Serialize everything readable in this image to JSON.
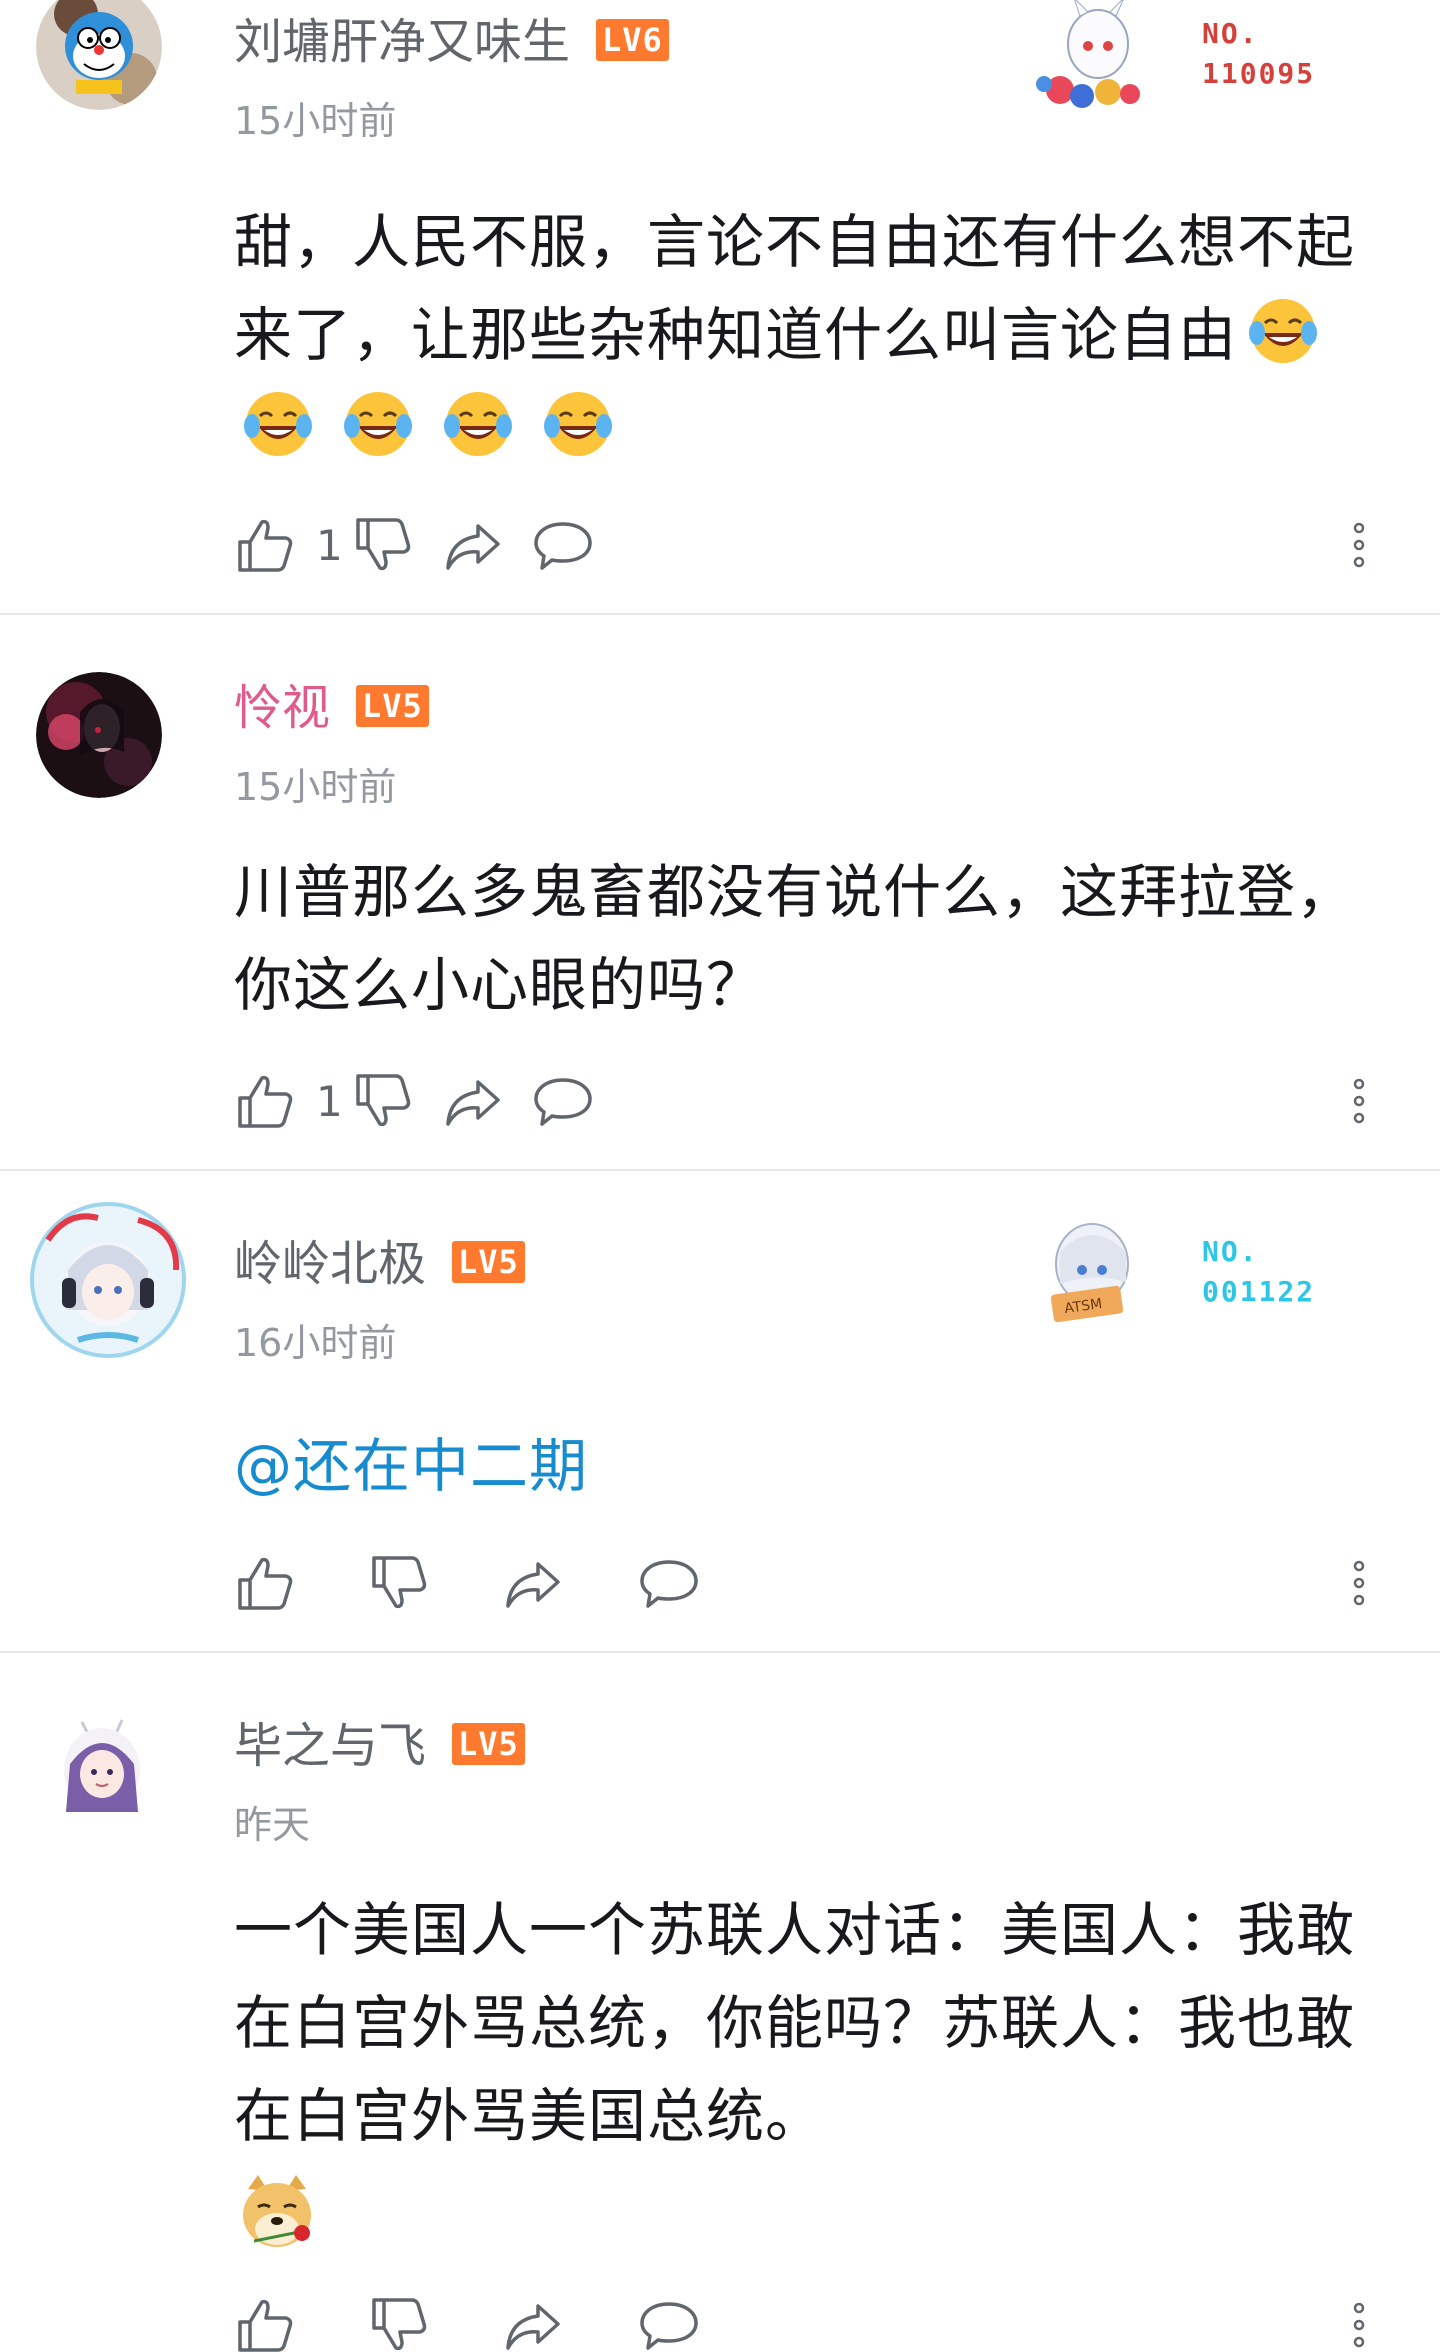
{
  "comments": [
    {
      "username": "刘墉肝净又味生",
      "level": "LV6",
      "time": "15小时前",
      "badge_no": "NO.",
      "badge_id": "110095",
      "text": "甜，人民不服，言论不自由还有什么想不起来了，让那些杂种知道什么叫言论自由",
      "emoji": "laugh-cry-emoji",
      "likes": "1"
    },
    {
      "username": "怜视",
      "level": "LV5",
      "time": "15小时前",
      "text": "川普那么多鬼畜都没有说什么，这拜拉登，你这么小心眼的吗？",
      "likes": "1"
    },
    {
      "username": "岭岭北极",
      "level": "LV5",
      "time": "16小时前",
      "badge_no": "NO.",
      "badge_id": "001122",
      "text": "@还在中二期",
      "likes": ""
    },
    {
      "username": "毕之与飞",
      "level": "LV5",
      "time": "昨天",
      "text": "一个美国人一个苏联人对话：美国人：我敢在白宫外骂总统，你能吗？苏联人：我也敢在白宫外骂美国总统。",
      "emoji": "doge-rose-emoji",
      "likes": ""
    }
  ],
  "icons": {
    "like": "thumbs-up-icon",
    "dislike": "thumbs-down-icon",
    "share": "share-icon",
    "reply": "reply-bubble-icon",
    "more": "more-vertical-icon"
  },
  "colors": {
    "level_badge": "#ff7a2e",
    "pink_name": "#e05a8b",
    "mention": "#178bcf",
    "badge_red": "#d6403a",
    "badge_cyan": "#2ec6e6"
  }
}
